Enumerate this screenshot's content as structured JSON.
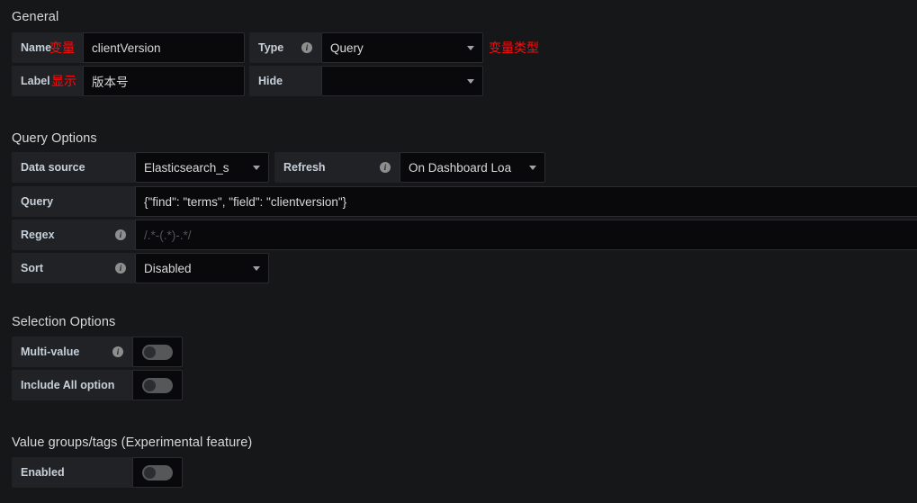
{
  "sections": {
    "general": "General",
    "query_options": "Query Options",
    "selection_options": "Selection Options",
    "value_groups": "Value groups/tags (Experimental feature)"
  },
  "general": {
    "name": {
      "label": "Name",
      "value": "clientVersion",
      "annotation": "变量"
    },
    "type": {
      "label": "Type",
      "value": "Query",
      "annotation": "变量类型",
      "info": "i"
    },
    "label_row": {
      "label": "Label",
      "value": "版本号",
      "annotation": "显示"
    },
    "hide": {
      "label": "Hide",
      "value": ""
    }
  },
  "query_options": {
    "data_source": {
      "label": "Data source",
      "value": "Elasticsearch_s"
    },
    "refresh": {
      "label": "Refresh",
      "value": "On Dashboard Loa",
      "info": "i"
    },
    "query": {
      "label": "Query",
      "value": "{\"find\": \"terms\", \"field\": \"clientversion\"}"
    },
    "regex": {
      "label": "Regex",
      "placeholder": "/.*-(.*)-.*/",
      "value": "",
      "info": "i"
    },
    "sort": {
      "label": "Sort",
      "value": "Disabled",
      "info": "i"
    }
  },
  "selection_options": {
    "multi_value": {
      "label": "Multi-value",
      "info": "i",
      "enabled": false
    },
    "include_all": {
      "label": "Include All option",
      "enabled": false
    }
  },
  "value_groups": {
    "enabled_row": {
      "label": "Enabled",
      "enabled": false
    }
  },
  "colors": {
    "page_background": "#161719",
    "label_background": "#202226",
    "input_background": "#09090b",
    "annotation_red": "#ff0a0a",
    "text": "#d8d9da"
  }
}
